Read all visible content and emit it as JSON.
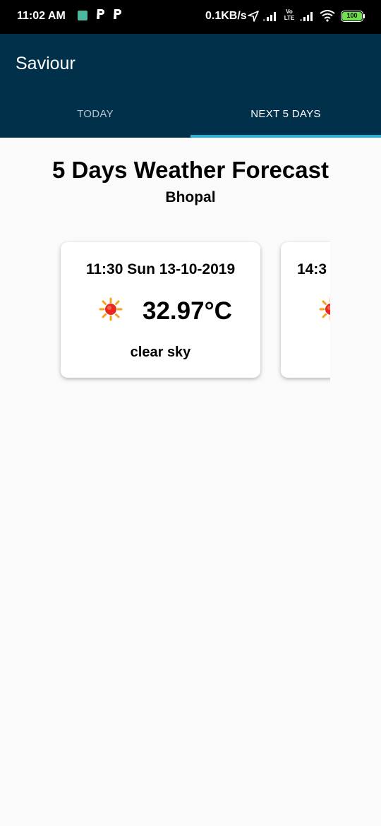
{
  "status_bar": {
    "time": "11:02 AM",
    "network_speed": "0.1KB/s",
    "volte_label": "Vo\nLTE",
    "battery": "100"
  },
  "app_bar": {
    "title": "Saviour",
    "tabs": [
      {
        "label": "TODAY",
        "selected": false
      },
      {
        "label": "NEXT 5 DAYS",
        "selected": true
      }
    ],
    "colors": {
      "bar": "#01304a",
      "indicator": "#24b2d8"
    }
  },
  "main": {
    "heading": "5 Days Weather Forecast",
    "city": "Bhopal",
    "forecasts": [
      {
        "datetime": "11:30 Sun 13-10-2019",
        "temperature": "32.97°C",
        "description": "clear sky",
        "icon": "sun-icon"
      },
      {
        "datetime": "14:3",
        "temperature": "",
        "description": "",
        "icon": "sun-icon"
      }
    ]
  }
}
